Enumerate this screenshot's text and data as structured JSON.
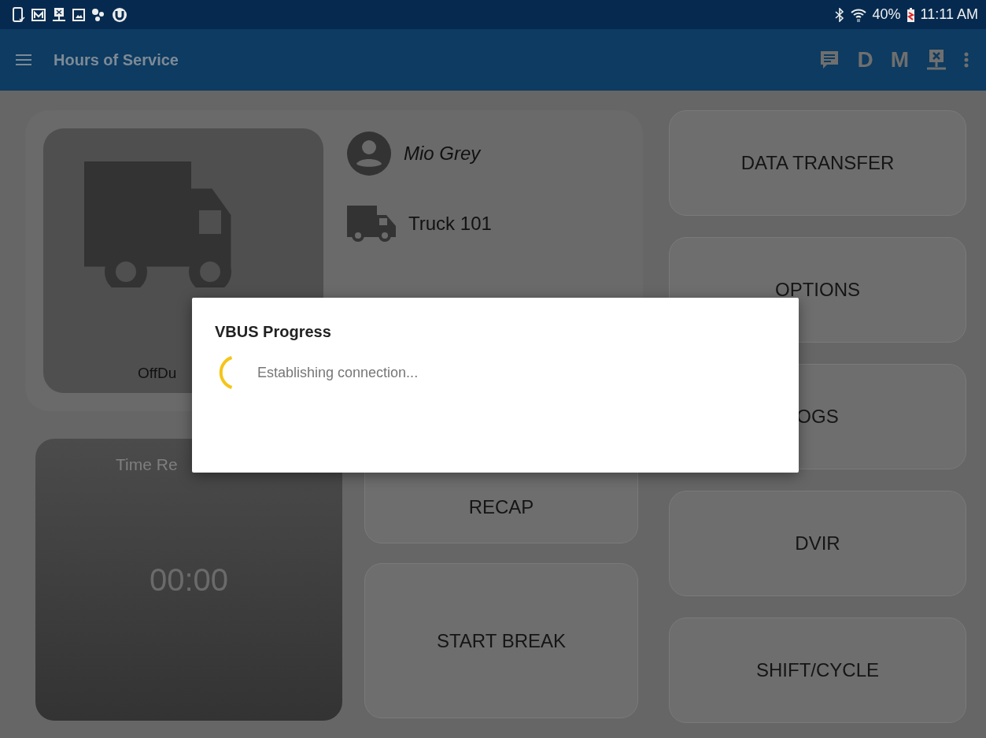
{
  "status_bar": {
    "battery": "40%",
    "time": "11:11 AM"
  },
  "app_bar": {
    "title": "Hours of Service",
    "actions": [
      "D",
      "M"
    ]
  },
  "driver": {
    "name": "Mio Grey"
  },
  "vehicle": {
    "name": "Truck 101"
  },
  "duty_status": {
    "label": "OffDu"
  },
  "time_remaining": {
    "label": "Time Re",
    "value": "00:00"
  },
  "center_buttons": [
    "RECAP",
    "START BREAK"
  ],
  "side_buttons": [
    "DATA TRANSFER",
    "OPTIONS",
    "OGS",
    "DVIR",
    "SHIFT/CYCLE"
  ],
  "dialog": {
    "title": "VBUS Progress",
    "message": "Establishing connection..."
  }
}
